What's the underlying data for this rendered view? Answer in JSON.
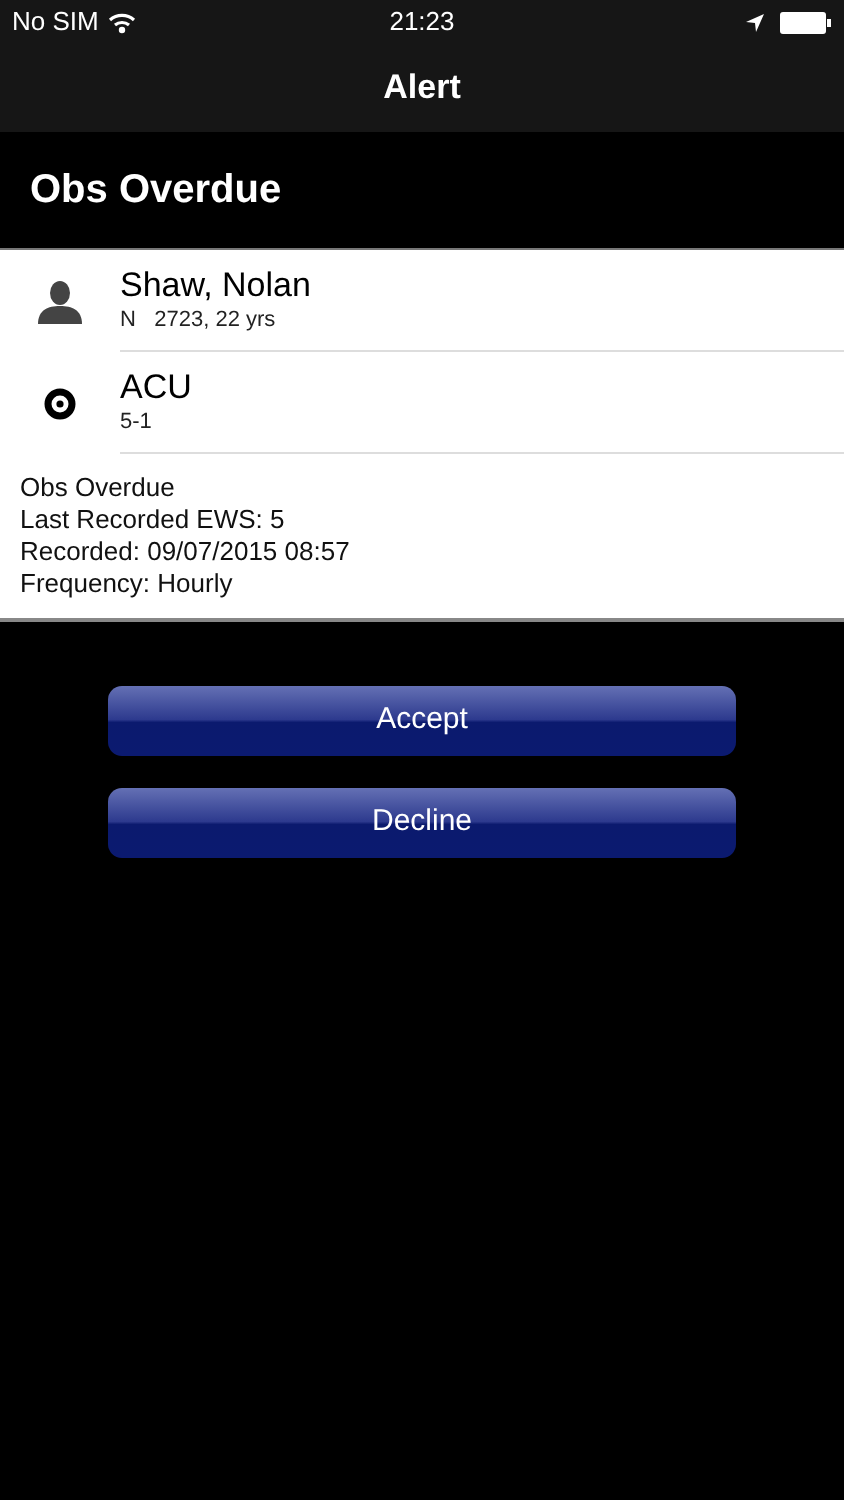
{
  "status_bar": {
    "carrier": "No SIM",
    "time": "21:23"
  },
  "nav_bar": {
    "title": "Alert"
  },
  "header": {
    "title": "Obs Overdue"
  },
  "rows": [
    {
      "kind": "person",
      "title": "Shaw, Nolan",
      "subtitle": "N   2723, 22 yrs"
    },
    {
      "kind": "location",
      "title": "ACU",
      "subtitle": "5-1"
    }
  ],
  "details": [
    "Obs Overdue",
    "Last Recorded EWS: 5",
    "Recorded: 09/07/2015 08:57",
    "Frequency: Hourly"
  ],
  "buttons": [
    "Accept",
    "Decline"
  ]
}
